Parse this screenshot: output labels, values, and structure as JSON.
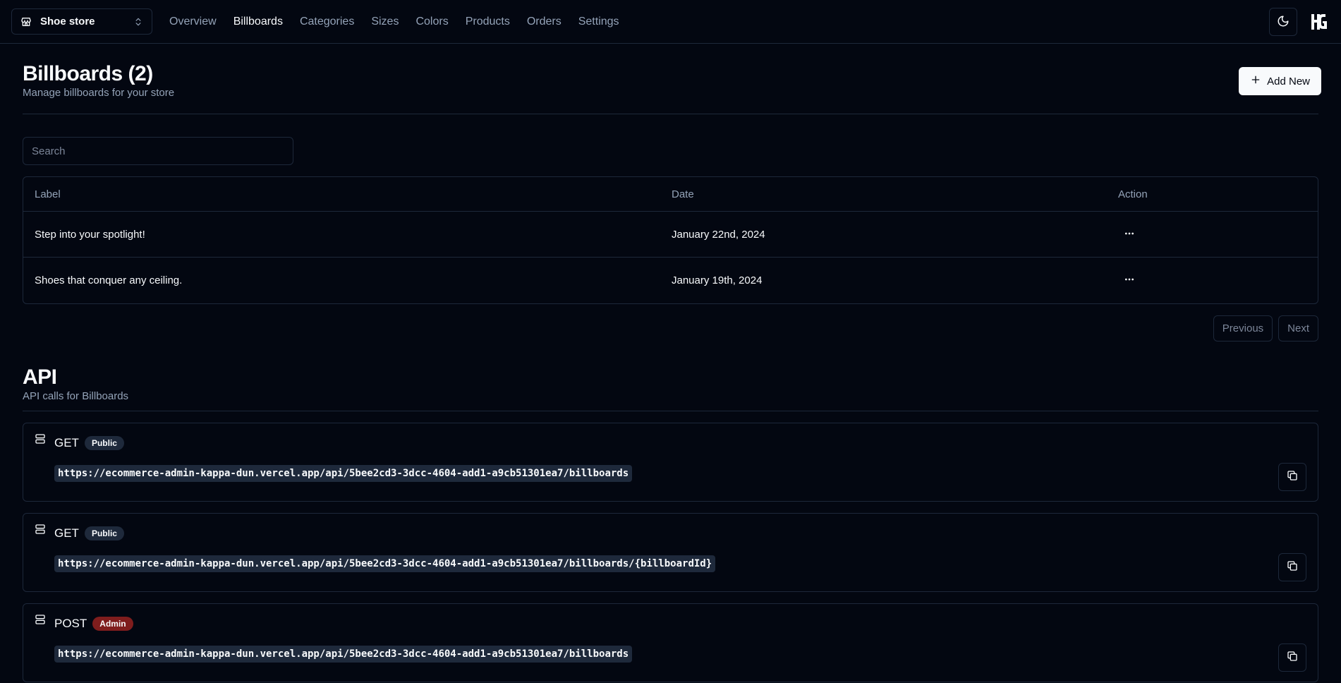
{
  "store_switcher": {
    "label": "Shoe store",
    "icon": "store-icon"
  },
  "nav": [
    {
      "label": "Overview",
      "active": false
    },
    {
      "label": "Billboards",
      "active": true
    },
    {
      "label": "Categories",
      "active": false
    },
    {
      "label": "Sizes",
      "active": false
    },
    {
      "label": "Colors",
      "active": false
    },
    {
      "label": "Products",
      "active": false
    },
    {
      "label": "Orders",
      "active": false
    },
    {
      "label": "Settings",
      "active": false
    }
  ],
  "header": {
    "title": "Billboards (2)",
    "description": "Manage billboards for your store",
    "add_label": "Add New"
  },
  "search": {
    "placeholder": "Search",
    "value": ""
  },
  "table": {
    "columns": [
      "Label",
      "Date",
      "Action"
    ],
    "rows": [
      {
        "label": "Step into your spotlight!",
        "date": "January 22nd, 2024"
      },
      {
        "label": "Shoes that conquer any ceiling.",
        "date": "January 19th, 2024"
      }
    ]
  },
  "pagination": {
    "previous": "Previous",
    "next": "Next"
  },
  "api": {
    "title": "API",
    "description": "API calls for Billboards",
    "endpoints": [
      {
        "method": "GET",
        "access": "Public",
        "url": "https://ecommerce-admin-kappa-dun.vercel.app/api/5bee2cd3-3dcc-4604-add1-a9cb51301ea7/billboards"
      },
      {
        "method": "GET",
        "access": "Public",
        "url": "https://ecommerce-admin-kappa-dun.vercel.app/api/5bee2cd3-3dcc-4604-add1-a9cb51301ea7/billboards/{billboardId}"
      },
      {
        "method": "POST",
        "access": "Admin",
        "url": "https://ecommerce-admin-kappa-dun.vercel.app/api/5bee2cd3-3dcc-4604-add1-a9cb51301ea7/billboards"
      }
    ]
  },
  "colors": {
    "background": "#030711",
    "border": "#1d283a",
    "muted_text": "#94a3b8",
    "admin_badge": "#7f1d1d"
  }
}
